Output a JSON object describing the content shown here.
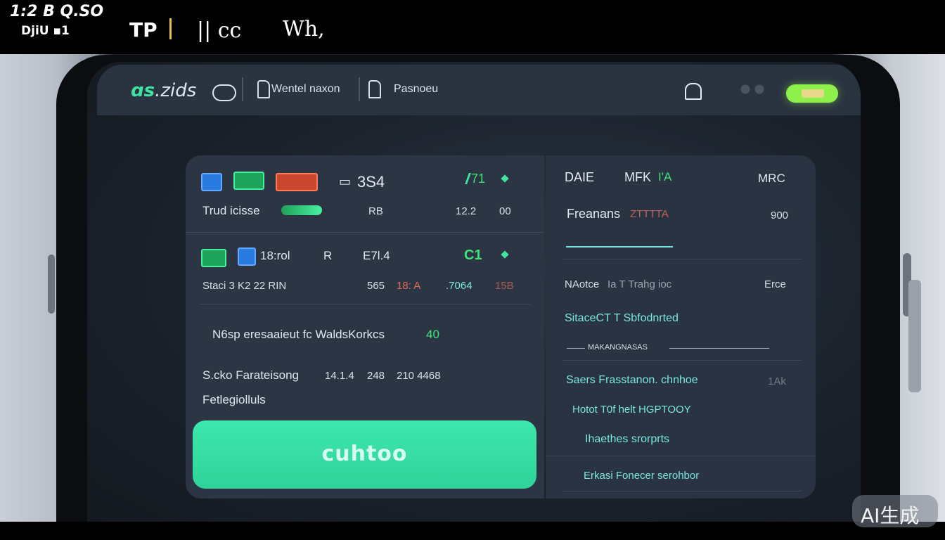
{
  "statusbar": {
    "clock_line1": "1:2 B Q.SO",
    "clock_line2": "DjiU ▪1",
    "app_short": "TP",
    "item_a": "|| cc",
    "item_b": "Wh,"
  },
  "appbar": {
    "logo_accent": "ɑs",
    "logo_text": ".zids",
    "nav_1_label": "Wentel naxon",
    "nav_2_label": "Pasnoeu"
  },
  "left_panel": {
    "row1_code": "3S4",
    "row1_badge": "71",
    "row2_label": "Trud icisse",
    "row2_val1": "RB",
    "row2_val2": "12.2",
    "row2_val3": "00",
    "row3_label": "18:rol",
    "row3_code": "R",
    "row3_val": "E7l.4",
    "row3_badge": "C1",
    "row4_label": "Staci 3 K2 22 RIN",
    "row4_val1": "565",
    "row4_val2": "18: A",
    "row4_val3": ".7064",
    "row4_val4": "15B",
    "notice": "N6sp eresaaieut fc WaldsKorkcs",
    "notice_badge": "40",
    "stats_label": "S.cko Farateisong",
    "stats_val1": "14.1.4",
    "stats_val2": "248",
    "stats_val3": "210 4468",
    "footer_label": "Fetlegiolluls",
    "cta_label": "cuhtoo"
  },
  "right_panel": {
    "col1": "DAIE",
    "col2": "MFK",
    "col2_accent": "I'A",
    "col3": "MRC",
    "item1_label": "Freanans",
    "item1_sub": "ZTTTTA",
    "item1_val": "900",
    "item2_label": "NAotce",
    "item2_sub": "Ia T Trahg ioc",
    "item2_val": "Erce",
    "item3_label": "SitaceCT T Sbfodnrted",
    "item3_sub": "MAKANGNASAS",
    "item4_label": "Saers Frasstanon. chnhoe",
    "item4_val": "1Ak",
    "item5_label": "Hotot T0f helt HGPTOOY",
    "item6_label": "Ihaethes srorprts",
    "item7_label": "Erkasi Fonecer serohbor"
  },
  "watermark": "AI生成",
  "colors": {
    "accent_green": "#3fe3a2",
    "accent_teal": "#7ae6e0",
    "panel_bg": "#2c3544",
    "toggle_on": "#8ef04a"
  }
}
